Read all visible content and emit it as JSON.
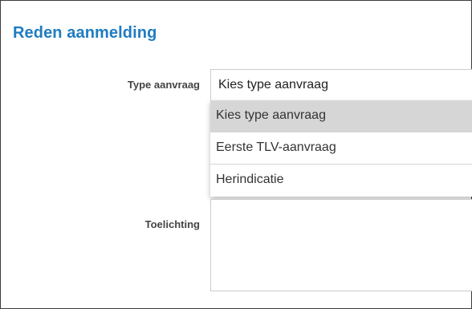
{
  "section": {
    "title": "Reden aanmelding"
  },
  "form": {
    "type_label": "Type aanvraag",
    "type_selected": "Kies type aanvraag",
    "type_options": [
      "Kies type aanvraag",
      "Eerste TLV-aanvraag",
      "Herindicatie"
    ],
    "toelichting_label": "Toelichting",
    "toelichting_value": ""
  },
  "colors": {
    "title": "#1f7cc1",
    "selected_option_bg": "#d6d6d6"
  }
}
